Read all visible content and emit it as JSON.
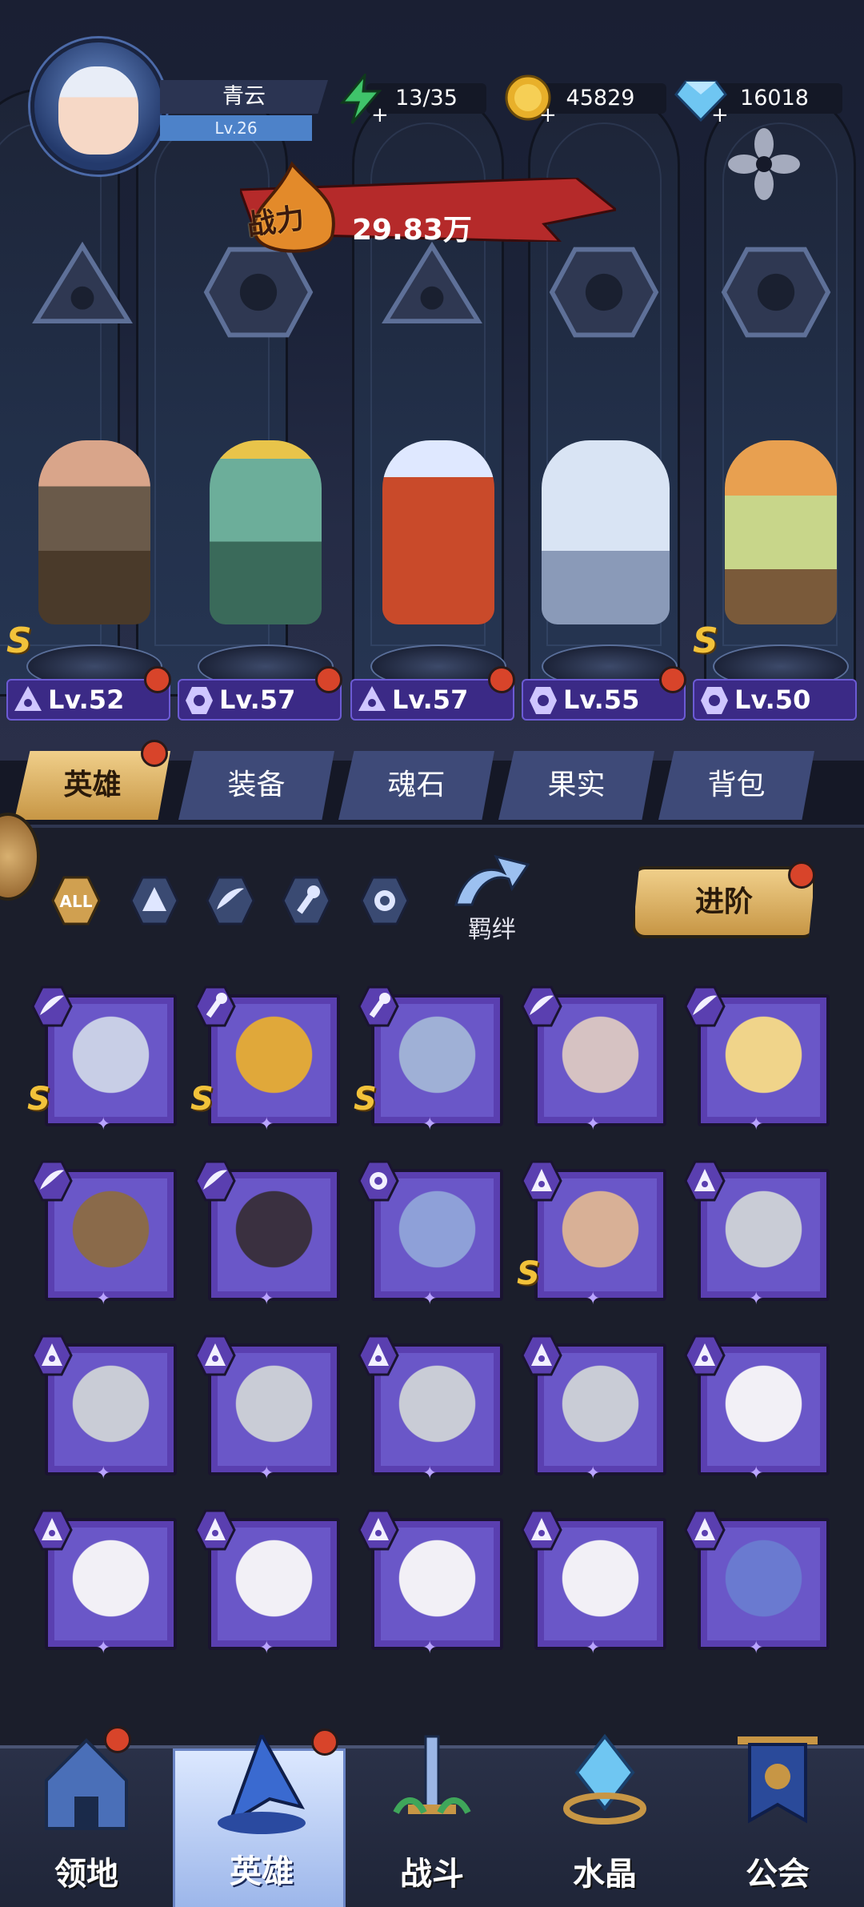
{
  "player": {
    "name": "青云",
    "level": "Lv.26"
  },
  "resources": {
    "stamina": "13/35",
    "gold": "45829",
    "diamond": "16018"
  },
  "power": {
    "label": "战力",
    "value": "29.83万"
  },
  "stage_heroes": [
    {
      "level": "Lv.52",
      "rank": "S",
      "class": "warrior"
    },
    {
      "level": "Lv.57",
      "rank": "",
      "class": "beast"
    },
    {
      "level": "Lv.57",
      "rank": "",
      "class": "warrior"
    },
    {
      "level": "Lv.55",
      "rank": "",
      "class": "beast"
    },
    {
      "level": "Lv.50",
      "rank": "S",
      "class": "beast"
    }
  ],
  "tabs": [
    "英雄",
    "装备",
    "魂石",
    "果实",
    "背包"
  ],
  "filters": {
    "all": "ALL",
    "bond": "羁绊"
  },
  "advance_button": "进阶",
  "roster": [
    {
      "class": "wing",
      "rank": "S"
    },
    {
      "class": "wrench",
      "rank": "S"
    },
    {
      "class": "wrench",
      "rank": "S"
    },
    {
      "class": "wing",
      "rank": ""
    },
    {
      "class": "wing",
      "rank": ""
    },
    {
      "class": "wing",
      "rank": ""
    },
    {
      "class": "wing",
      "rank": ""
    },
    {
      "class": "beast",
      "rank": ""
    },
    {
      "class": "warrior",
      "rank": "S"
    },
    {
      "class": "warrior",
      "rank": ""
    },
    {
      "class": "warrior",
      "rank": ""
    },
    {
      "class": "warrior",
      "rank": ""
    },
    {
      "class": "warrior",
      "rank": ""
    },
    {
      "class": "warrior",
      "rank": ""
    },
    {
      "class": "warrior",
      "rank": ""
    },
    {
      "class": "warrior",
      "rank": ""
    },
    {
      "class": "warrior",
      "rank": ""
    },
    {
      "class": "warrior",
      "rank": ""
    },
    {
      "class": "warrior",
      "rank": ""
    },
    {
      "class": "warrior",
      "rank": ""
    }
  ],
  "bottom_nav": [
    "领地",
    "英雄",
    "战斗",
    "水晶",
    "公会"
  ],
  "colors": {
    "accent": "#c79645",
    "card": "#5a3fb0",
    "level_bar": "#3b2a86",
    "notify": "#d8442a"
  }
}
